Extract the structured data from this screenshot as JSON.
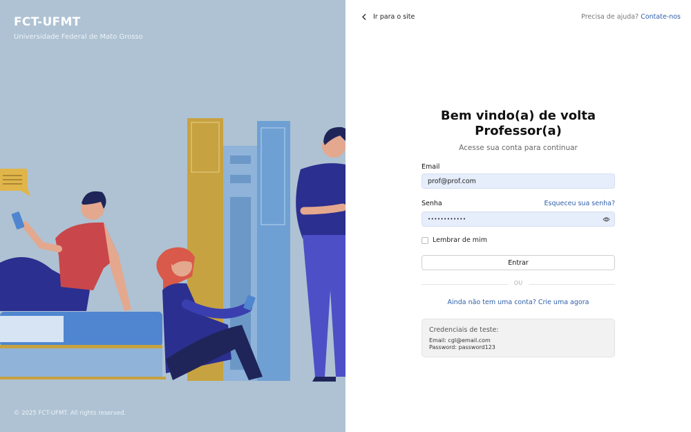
{
  "brand": {
    "name": "FCT-UFMT",
    "subtitle": "Universidade Federal de Mato Grosso",
    "copyright": "© 2025 FCT-UFMT. All rights reserved."
  },
  "header": {
    "back_label": "Ir para o site",
    "help_text": "Precisa de ajuda?",
    "help_link": "Contate-nos"
  },
  "login": {
    "title_line1": "Bem vindo(a) de volta",
    "title_line2": "Professor(a)",
    "subtitle": "Acesse sua conta para continuar",
    "email_label": "Email",
    "email_value": "prof@prof.com",
    "password_label": "Senha",
    "password_value": "••••••••••••",
    "forgot_label": "Esqueceu sua senha?",
    "remember_label": "Lembrar de mim",
    "submit_label": "Entrar",
    "divider_label": "OU",
    "signup_label": "Ainda não tem uma conta? Crie uma agora"
  },
  "test_credentials": {
    "title": "Credenciais de teste:",
    "email_line": "Email: cgl@email.com",
    "password_line": "Password: password123"
  },
  "colors": {
    "left_bg": "#aec2d3",
    "link": "#2f5fa8",
    "input_bg": "#e6eefc"
  }
}
